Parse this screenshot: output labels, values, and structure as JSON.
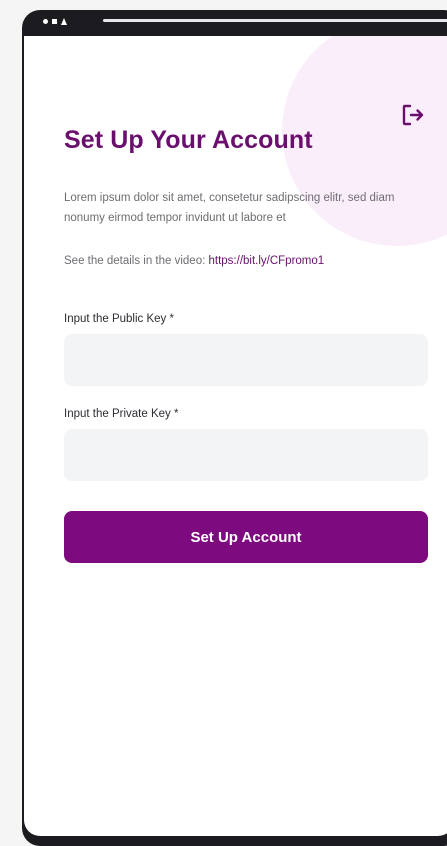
{
  "header": {
    "title": "Set Up Your Account",
    "logout_icon": "logout-icon"
  },
  "intro": {
    "description": "Lorem ipsum dolor sit amet, consetetur sadipscing elitr, sed diam nonumy eirmod tempor invidunt ut labore et",
    "video_prefix": "See the details in the video: ",
    "video_link": "https://bit.ly/CFpromo1"
  },
  "form": {
    "public_key_label": "Input the Public Key *",
    "public_key_value": "",
    "private_key_label": "Input the Private Key *",
    "private_key_value": "",
    "submit_label": "Set Up Account"
  },
  "colors": {
    "brand": "#7d0a7e",
    "title": "#6a0f6e",
    "input_bg": "#f3f4f6",
    "accent_blob": "#fbeefb"
  }
}
